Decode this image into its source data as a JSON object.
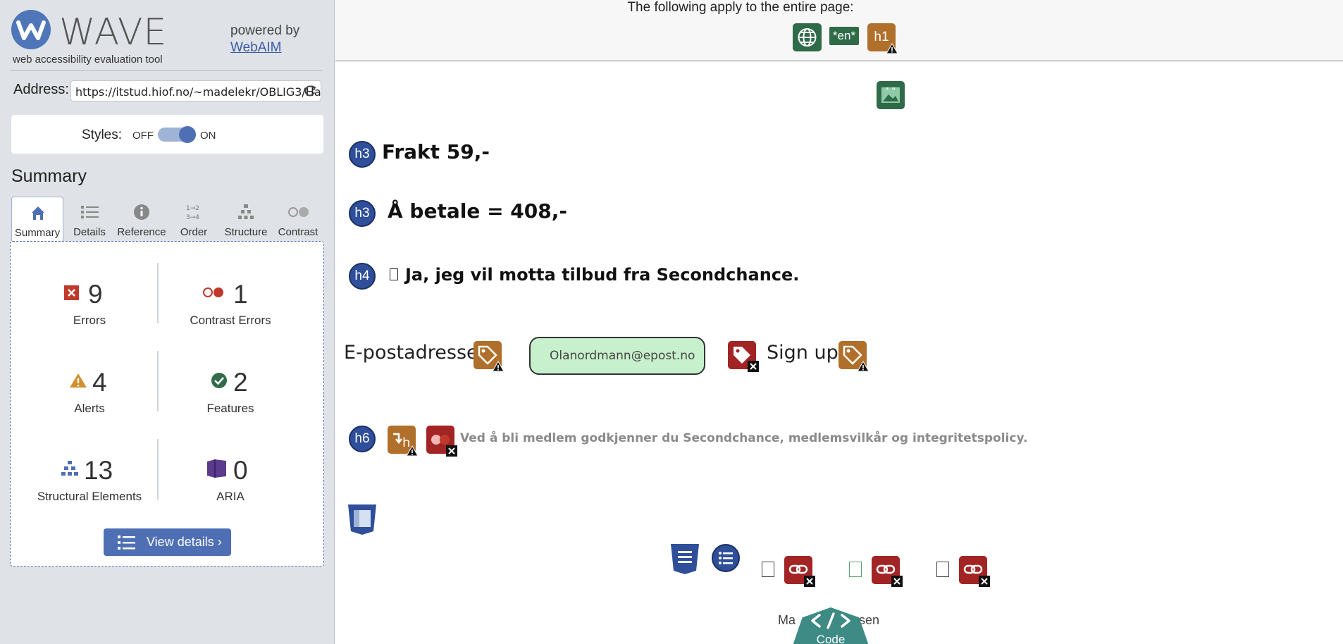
{
  "sidebar": {
    "brand": {
      "title": "WAVE",
      "subtitle": "web accessibility evaluation tool",
      "powered_by": "powered by",
      "webaim_link": "WebAIM"
    },
    "address": {
      "label": "Address:",
      "value": "https://itstud.hiof.no/~madelekr/OBLIG3/Ha"
    },
    "styles": {
      "label": "Styles:",
      "off": "OFF",
      "on": "ON",
      "state": "on"
    },
    "summary_heading": "Summary",
    "tabs": [
      {
        "label": "Summary",
        "icon": "home-icon",
        "active": true
      },
      {
        "label": "Details",
        "icon": "list-icon",
        "active": false
      },
      {
        "label": "Reference",
        "icon": "info-icon",
        "active": false
      },
      {
        "label": "Order",
        "icon": "order-icon",
        "active": false
      },
      {
        "label": "Structure",
        "icon": "structure-icon",
        "active": false
      },
      {
        "label": "Contrast",
        "icon": "contrast-icon",
        "active": false
      }
    ],
    "stats": {
      "errors": {
        "count": "9",
        "label": "Errors"
      },
      "contrast_errors": {
        "count": "1",
        "label": "Contrast Errors"
      },
      "alerts": {
        "count": "4",
        "label": "Alerts"
      },
      "features": {
        "count": "2",
        "label": "Features"
      },
      "structural": {
        "count": "13",
        "label": "Structural Elements"
      },
      "aria": {
        "count": "0",
        "label": "ARIA"
      }
    },
    "view_details": "View details ›"
  },
  "main": {
    "page_notice": "The following apply to the entire page:",
    "lang_badge": "*en*",
    "h1_badge": "h1",
    "headings": [
      {
        "level": "h3",
        "text": "Frakt 59,-"
      },
      {
        "level": "h3",
        "text": "Å betale = 408,-"
      },
      {
        "level": "h4",
        "text": "Ja, jeg vil motta tilbud fra Secondchance."
      },
      {
        "level": "h6",
        "text": "Ved å bli medlem godkjenner du Secondchance, medlemsvilkår og integritetspolicy."
      }
    ],
    "form": {
      "email_label": "E-postadresse",
      "email_value": "Olanordmann@epost.no",
      "signup_label": "Sign up"
    },
    "footer_partial": "Ma                nsen",
    "code_button": "Code"
  },
  "colors": {
    "accent": "#4f6fb5",
    "error": "#a32424",
    "alert": "#b06f2a",
    "feature": "#2f6b48",
    "structure": "#2f4f9a",
    "sidebar_bg": "#dfe2e6"
  }
}
